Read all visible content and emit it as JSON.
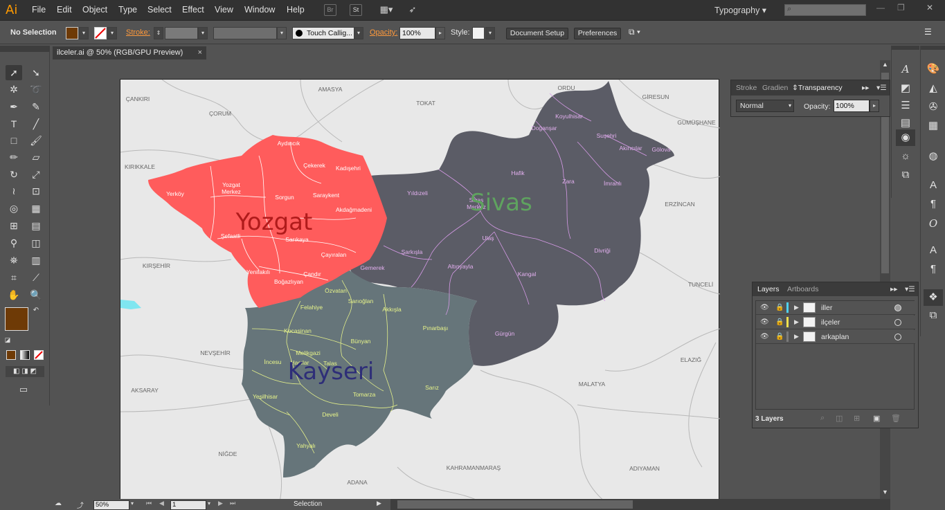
{
  "app": {
    "logo": "Ai",
    "menus": [
      "File",
      "Edit",
      "Object",
      "Type",
      "Select",
      "Effect",
      "View",
      "Window",
      "Help"
    ],
    "bridge_label": "Br",
    "stock_label": "St",
    "workspace": "Typography",
    "accent": "#ff9a00"
  },
  "control_bar": {
    "selection_status": "No Selection",
    "fill_color": "#6e3a06",
    "stroke_label": "Stroke:",
    "brush_name": "Touch Callig...",
    "opacity_label": "Opacity:",
    "opacity_value": "100%",
    "style_label": "Style:",
    "document_setup": "Document Setup",
    "preferences": "Preferences"
  },
  "document": {
    "tab_title": "ilceler.ai @ 50% (RGB/GPU Preview)",
    "close_glyph": "×"
  },
  "map": {
    "provinces": [
      {
        "name": "Yozgat",
        "color": "#ff5c5c",
        "label_color": "#b01b1b"
      },
      {
        "name": "Sivas",
        "color": "#5b5c66",
        "label_color": "#5fa35f"
      },
      {
        "name": "Kayseri",
        "color": "#66757a",
        "label_color": "#2e2e78"
      }
    ],
    "neighbors": [
      "AMASYA",
      "TOKAT",
      "ORDU",
      "GİRESUN",
      "ÇANKIRI",
      "ÇORUM",
      "GÜMÜŞHANE",
      "KIRIKKALE",
      "ERZİNCAN",
      "KIRŞEHİR",
      "TUNCELİ",
      "NEVŞEHİR",
      "ELAZIĞ",
      "AKSARAY",
      "MALATYA",
      "NİĞDE",
      "KAHRAMANMARAŞ",
      "ADIYAMAN",
      "ADANA"
    ],
    "yozgat_districts": [
      "Aydıncık",
      "Çekerek",
      "Kadışehri",
      "Yerköy",
      "Yozgat Merkez",
      "Sorgun",
      "Saraykent",
      "Akdağmadeni",
      "Şefaatli",
      "Sarıkaya",
      "Çayıralan",
      "Yenifakılı",
      "Çandır",
      "Boğazlıyan"
    ],
    "sivas_districts": [
      "Koyulhisar",
      "Doğanşar",
      "Suşehri",
      "Akıncılar",
      "Gölova",
      "Hafik",
      "Zara",
      "İmranlı",
      "Yıldızeli",
      "Sivas Merkez",
      "Ulaş",
      "Şarkışla",
      "Gemerek",
      "Altınyayla",
      "Divriği",
      "Kangal",
      "Gürgün"
    ],
    "kayseri_districts": [
      "Özvatan",
      "Felahiye",
      "Sarıoğlan",
      "Akkışla",
      "Pınarbaşı",
      "Kocasinan",
      "Bünyan",
      "İncesu",
      "Melikgazi",
      "Hacılar",
      "Talas",
      "Sarız",
      "Yeşilhisar",
      "Tomarza",
      "Develi",
      "Yahyalı"
    ]
  },
  "transparency_panel": {
    "tabs": [
      "Stroke",
      "Gradien",
      "Transparency"
    ],
    "blend_mode": "Normal",
    "opacity_label": "Opacity:",
    "opacity_value": "100%"
  },
  "layers_panel": {
    "tabs": [
      "Layers",
      "Artboards"
    ],
    "layers": [
      {
        "name": "iller",
        "color": "#4fd2f0"
      },
      {
        "name": "ilçeler",
        "color": "#f0e04f"
      },
      {
        "name": "arkaplan",
        "color": "#7a7a7a"
      }
    ],
    "count_label": "3 Layers"
  },
  "status_bar": {
    "zoom": "50%",
    "artboard_number": "1",
    "current_tool": "Selection"
  }
}
